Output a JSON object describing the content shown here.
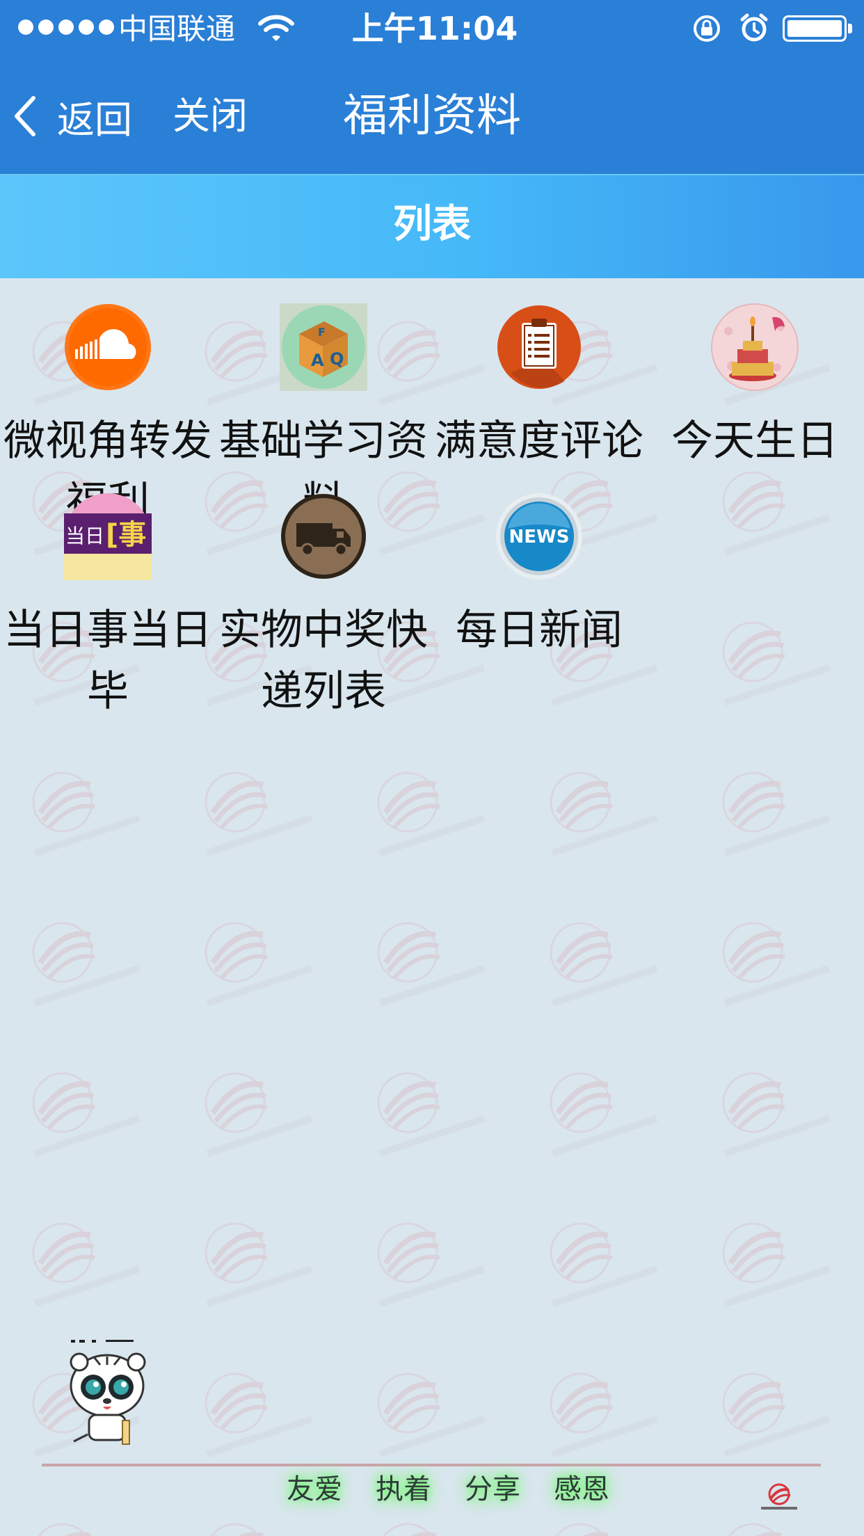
{
  "status_bar": {
    "carrier": "中国联通",
    "time": "上午11:04",
    "battery_level": 1.0
  },
  "nav": {
    "back_label": "返回",
    "close_label": "关闭",
    "title": "福利资料"
  },
  "section": {
    "title": "列表"
  },
  "items": [
    {
      "label": "微视角转发福利",
      "icon": "soundcloud-icon"
    },
    {
      "label": "基础学习资料",
      "icon": "faq-blocks-icon"
    },
    {
      "label": "满意度评论",
      "icon": "clipboard-icon"
    },
    {
      "label": "今天生日",
      "icon": "birthday-cake-icon"
    },
    {
      "label": "当日事当日毕",
      "icon": "dangrishi-icon"
    },
    {
      "label": "实物中奖快递列表",
      "icon": "delivery-truck-icon"
    },
    {
      "label": "每日新闻",
      "icon": "news-icon"
    }
  ],
  "footer": {
    "motto": [
      "友爱",
      "执着",
      "分享",
      "感恩"
    ]
  },
  "colors": {
    "nav_blue": "#2a7fd6",
    "header_light_blue": "#45b8f8",
    "background": "#d9e6ee"
  }
}
